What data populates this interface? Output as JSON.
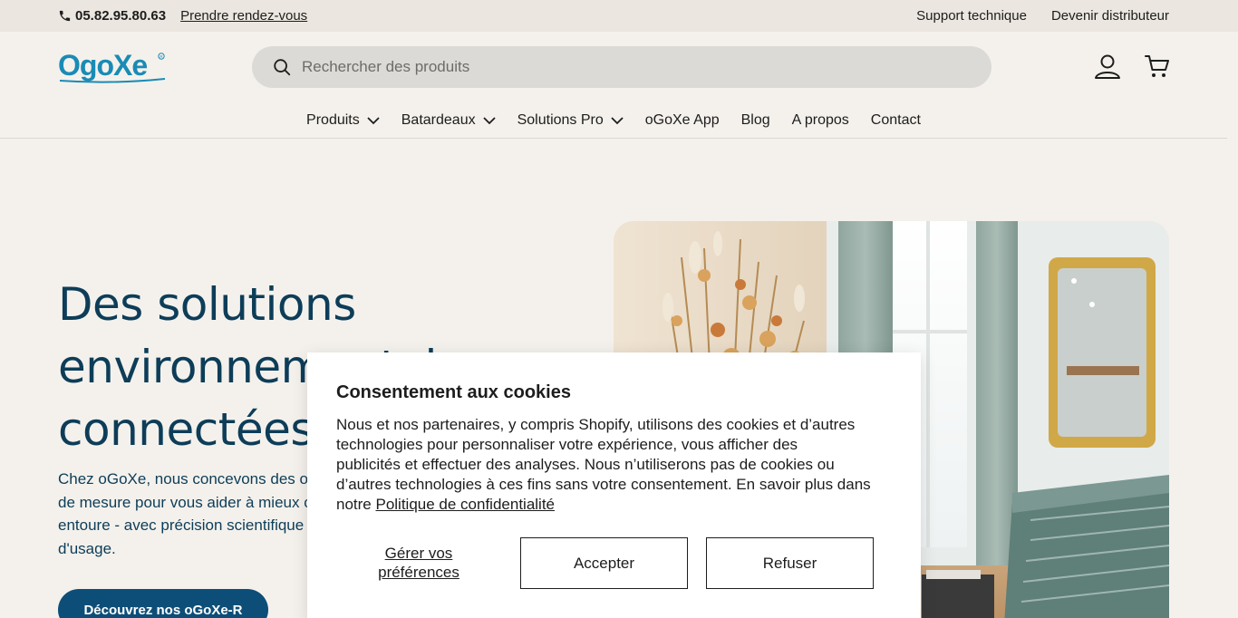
{
  "topbar": {
    "phone": "05.82.95.80.63",
    "appointment_link": "Prendre rendez-vous",
    "support_link": "Support technique",
    "distributor_link": "Devenir distributeur"
  },
  "header": {
    "logo_text": "OgoXe",
    "search_placeholder": "Rechercher des produits",
    "icons": [
      "search-icon",
      "account-icon",
      "cart-icon"
    ]
  },
  "nav": {
    "items": [
      {
        "label": "Produits",
        "dropdown": true
      },
      {
        "label": "Batardeaux",
        "dropdown": true
      },
      {
        "label": "Solutions Pro",
        "dropdown": true
      },
      {
        "label": "oGoXe App",
        "dropdown": false
      },
      {
        "label": "Blog",
        "dropdown": false
      },
      {
        "label": "A propos",
        "dropdown": false
      },
      {
        "label": "Contact",
        "dropdown": false
      }
    ]
  },
  "hero": {
    "title_lines": [
      "Des solutions",
      "environnementales",
      "connectées."
    ],
    "description_lines": [
      "Chez oGoXe, nous concevons des outils",
      "de mesure pour vous aider à mieux comprendre ce qui vous",
      "entoure - avec précision scientifique et simplicité",
      "d'usage."
    ],
    "cta_label": "Découvrez nos oGoXe-R"
  },
  "cookie": {
    "title": "Consentement aux cookies",
    "text_lines": [
      "Nous et nos partenaires, y compris Shopify, utilisons des cookies et d’autres",
      "technologies pour personnaliser votre expérience, vous afficher des",
      "publicités et effectuer des analyses. Nous n’utiliserons pas de cookies ou",
      "d’autres technologies à ces fins sans votre consentement. En savoir plus dans"
    ],
    "text_prefix": "notre ",
    "privacy_link": "Politique de confidentialité",
    "preferences_label_1": "Gérer vos",
    "preferences_label_2": "préférences",
    "accept_label": "Accepter",
    "refuse_label": "Refuser"
  },
  "colors": {
    "brand_blue": "#0d4e78",
    "heading_blue": "#0d3d58",
    "logo_blue": "#1a8bb5",
    "background": "#f4f1ec",
    "topbar_bg": "#ebe6df"
  }
}
